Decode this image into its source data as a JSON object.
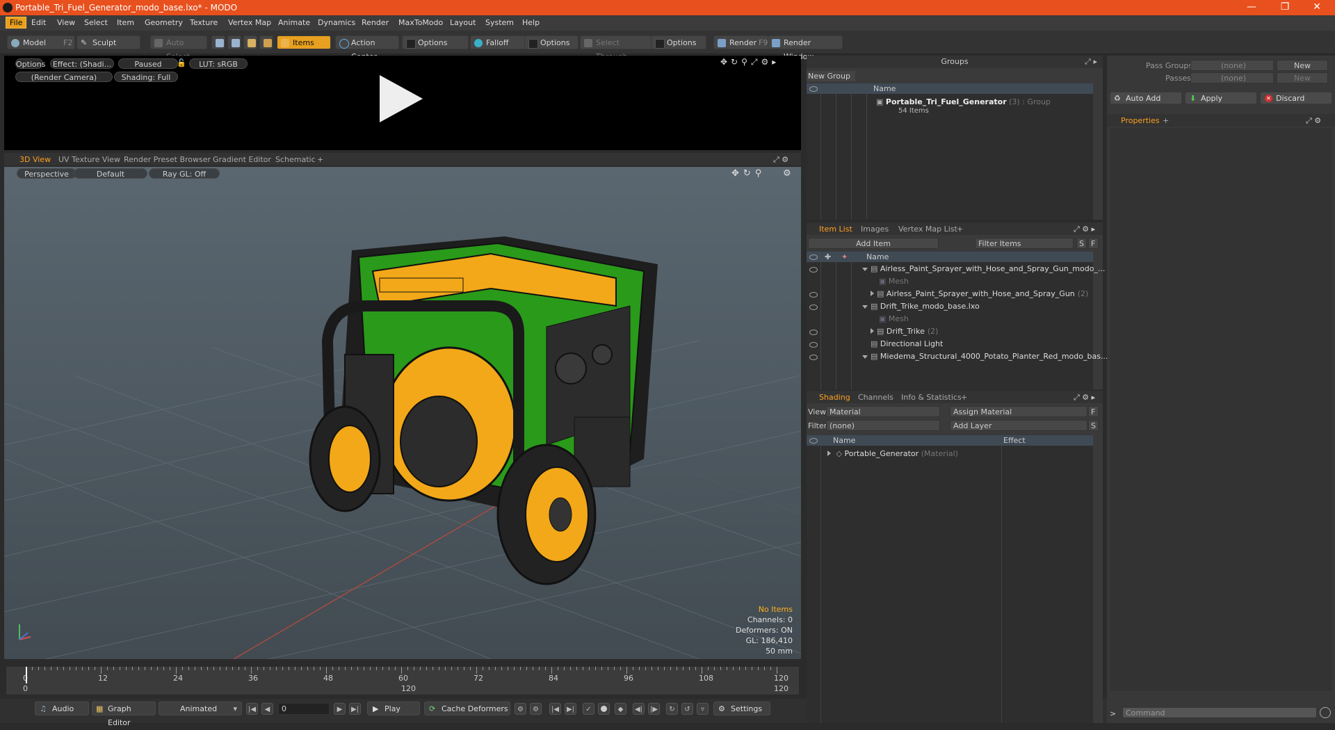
{
  "window": {
    "title": "Portable_Tri_Fuel_Generator_modo_base.lxo* - MODO"
  },
  "menu": [
    "File",
    "Edit",
    "View",
    "Select",
    "Item",
    "Geometry",
    "Texture",
    "Vertex Map",
    "Animate",
    "Dynamics",
    "Render",
    "MaxToModo",
    "Layout",
    "System",
    "Help"
  ],
  "toolbar": {
    "model": "Model",
    "model_key": "F2",
    "sculpt": "Sculpt",
    "auto_select": "Auto Select",
    "items": "Items",
    "action_center": "Action Center",
    "options1": "Options",
    "falloff": "Falloff",
    "options2": "Options",
    "select_through": "Select Through",
    "options3": "Options",
    "render": "Render",
    "render_key": "F9",
    "render_window": "Render Window"
  },
  "preview": {
    "options": "Options",
    "effect": "Effect: (Shadi...",
    "paused": "Paused",
    "lut": "LUT: sRGB",
    "camera": "(Render Camera)",
    "shading": "Shading: Full"
  },
  "view_tabs": [
    "3D View",
    "UV Texture View",
    "Render Preset Browser",
    "Gradient Editor",
    "Schematic"
  ],
  "viewport": {
    "perspective": "Perspective",
    "default": "Default",
    "raygl": "Ray GL: Off",
    "info": [
      "No Items",
      "Channels: 0",
      "Deformers: ON",
      "GL: 186,410",
      "50 mm"
    ]
  },
  "groups": {
    "title": "Groups",
    "new_group": "New Group",
    "col_name": "Name",
    "item_name": "Portable_Tri_Fuel_Generator",
    "item_count": "(3)",
    "item_type": ": Group",
    "item_sub": "54 Items"
  },
  "item_list": {
    "tabs": [
      "Item List",
      "Images",
      "Vertex Map List"
    ],
    "add_item": "Add Item",
    "filter": "Filter Items",
    "s": "S",
    "f": "F",
    "col_name": "Name",
    "rows": [
      {
        "text": "Airless_Paint_Sprayer_with_Hose_and_Spray_Gun_modo_...",
        "indent": 0,
        "dim": false,
        "tri": "down"
      },
      {
        "text": "Mesh",
        "indent": 2,
        "dim": true,
        "tri": ""
      },
      {
        "text": "Airless_Paint_Sprayer_with_Hose_and_Spray_Gun",
        "extra": "(2)",
        "indent": 1,
        "dim": false,
        "tri": "right"
      },
      {
        "text": "Drift_Trike_modo_base.lxo",
        "indent": 0,
        "dim": false,
        "tri": "down"
      },
      {
        "text": "Mesh",
        "indent": 2,
        "dim": true,
        "tri": ""
      },
      {
        "text": "Drift_Trike",
        "extra": "(2)",
        "indent": 1,
        "dim": false,
        "tri": "right"
      },
      {
        "text": "Directional Light",
        "indent": 1,
        "dim": false,
        "tri": ""
      },
      {
        "text": "Miedema_Structural_4000_Potato_Planter_Red_modo_bas...",
        "indent": 0,
        "dim": false,
        "tri": "down"
      }
    ]
  },
  "shading": {
    "tabs": [
      "Shading",
      "Channels",
      "Info & Statistics"
    ],
    "view_label": "View",
    "view_value": "Material",
    "assign": "Assign Material",
    "filter_label": "Filter",
    "filter_value": "(none)",
    "add_layer": "Add Layer",
    "col_name": "Name",
    "col_effect": "Effect",
    "item": "Portable_Generator",
    "item_type": "(Material)"
  },
  "right_panel": {
    "pass_groups": "Pass Groups",
    "passes": "Passes",
    "none": "(none)",
    "new": "New",
    "auto_add": "Auto Add",
    "apply": "Apply",
    "discard": "Discard",
    "properties": "Properties"
  },
  "timeline": {
    "labels": [
      "0",
      "12",
      "24",
      "36",
      "48",
      "60",
      "72",
      "84",
      "96",
      "108",
      "120"
    ],
    "sub_labels": [
      "0",
      "120",
      "120"
    ]
  },
  "bottom": {
    "audio": "Audio",
    "graph_editor": "Graph Editor",
    "animated": "Animated",
    "frame": "0",
    "play": "Play",
    "cache": "Cache Deformers",
    "settings": "Settings",
    "command": "Command"
  },
  "colors": {
    "accent": "#e8a020",
    "title": "#e8501d",
    "generator_green": "#2a9a1a",
    "generator_yellow": "#f2a818"
  }
}
